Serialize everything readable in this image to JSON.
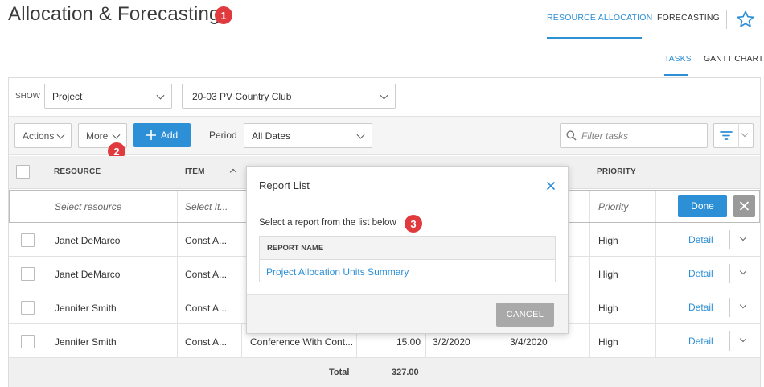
{
  "header": {
    "title": "Allocation & Forecasting",
    "nav": [
      "RESOURCE ALLOCATION",
      "FORECASTING"
    ],
    "active_nav": "RESOURCE ALLOCATION"
  },
  "subnav": [
    "TASKS",
    "GANTT CHART"
  ],
  "filters": {
    "show_label": "SHOW",
    "show_value": "Project",
    "project_value": "20-03 PV Country Club"
  },
  "toolbar": {
    "actions": "Actions",
    "more": "More",
    "add": "Add",
    "period_label": "Period",
    "period_value": "All Dates",
    "filter_placeholder": "Filter tasks"
  },
  "table": {
    "headers": {
      "resource": "RESOURCE",
      "item": "ITEM",
      "priority": "PRIORITY"
    },
    "edit_row": {
      "resource": "Select resource",
      "item": "Select It...",
      "priority": "Priority",
      "done": "Done"
    },
    "rows": [
      {
        "resource": "Janet DeMarco",
        "item": "Const A...",
        "desc": "",
        "units": "",
        "start": "",
        "end": "",
        "priority": "High",
        "detail": "Detail"
      },
      {
        "resource": "Janet DeMarco",
        "item": "Const A...",
        "desc": "",
        "units": "",
        "start": "",
        "end": "",
        "priority": "High",
        "detail": "Detail"
      },
      {
        "resource": "Jennifer Smith",
        "item": "Const A...",
        "desc": "",
        "units": "",
        "start": "",
        "end": "",
        "priority": "High",
        "detail": "Detail"
      },
      {
        "resource": "Jennifer Smith",
        "item": "Const A...",
        "desc": "Conference With Cont...",
        "units": "15.00",
        "start": "3/2/2020",
        "end": "3/4/2020",
        "priority": "High",
        "detail": "Detail"
      }
    ],
    "total_label": "Total",
    "total_value": "327.00"
  },
  "modal": {
    "title": "Report List",
    "instruction": "Select a report from the list below",
    "column": "REPORT NAME",
    "reports": [
      "Project Allocation Units Summary"
    ],
    "cancel": "CANCEL"
  },
  "badges": [
    "1",
    "2",
    "3"
  ],
  "colors": {
    "accent": "#2d8fd6",
    "badge": "#e0393e"
  }
}
